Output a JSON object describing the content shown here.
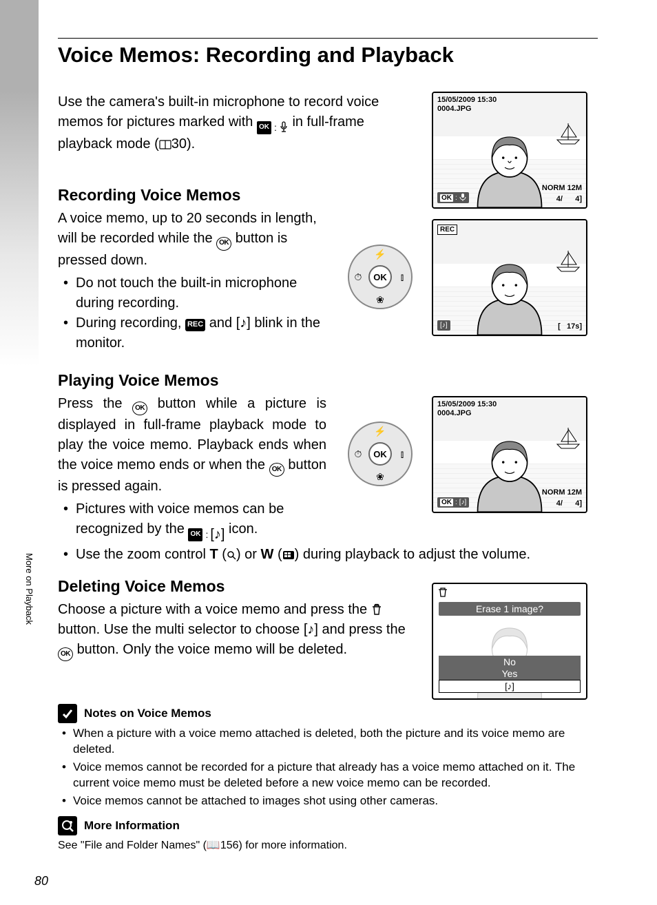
{
  "title": "Voice Memos: Recording and Playback",
  "intro": "Use the camera's built-in microphone to record voice memos for pictures marked with",
  "intro_after": " in full-frame playback mode (",
  "intro_ref": "30).",
  "section1": {
    "heading": "Recording Voice Memos",
    "body": "A voice memo, up to 20 seconds in length, will be recorded while the ",
    "body2": " button is pressed down.",
    "bullets": [
      "Do not touch the built-in microphone during recording.",
      "During recording, REC and [♪] blink in the monitor."
    ]
  },
  "section2": {
    "heading": "Playing Voice Memos",
    "body_a": "Press the ",
    "body_b": " button while a picture is displayed in full-frame playback mode to play the voice memo. Playback ends when the voice memo ends or when the ",
    "body_c": " button is pressed again.",
    "bullets": [
      "Pictures with voice memos can be recognized by the OK : [♪] icon.",
      "Use the zoom control T (🔍) or W (⊞) during playback to adjust the volume."
    ]
  },
  "section3": {
    "heading": "Deleting Voice Memos",
    "body_a": "Choose a picture with a voice memo and press the ",
    "body_b": " button. Use the multi selector to choose [♪] and press the ",
    "body_c": " button. Only the voice memo will be deleted."
  },
  "notes": {
    "heading": "Notes on Voice Memos",
    "bullets": [
      "When a picture with a voice memo attached is deleted, both the picture and its voice memo are deleted.",
      "Voice memos cannot be recorded for a picture that already has a voice memo attached on it. The current voice memo must be deleted before a new voice memo can be recorded.",
      "Voice memos cannot be attached to images shot using other cameras."
    ]
  },
  "more_info": {
    "heading": "More Information",
    "body": "See \"File and Folder Names\" (📖156) for more information."
  },
  "side_tab": "More on Playback",
  "page_num": "80",
  "screens": {
    "s1": {
      "date": "15/05/2009 15:30",
      "file": "0004.JPG",
      "norm": "NORM",
      "size": "12M",
      "count": "4/      4]",
      "ok_label": "OK"
    },
    "s2": {
      "rec": "REC",
      "time": "[   17s]"
    },
    "s3": {
      "date": "15/05/2009 15:30",
      "file": "0004.JPG",
      "norm": "NORM",
      "size": "12M",
      "count": "4/      4]",
      "ok_label": "OK"
    },
    "erase": {
      "prompt": "Erase 1 image?",
      "no": "No",
      "yes": "Yes",
      "memo_glyph": "[♪]"
    }
  },
  "icons": {
    "ok": "OK",
    "rec": "REC",
    "trash": "🗑",
    "book": "📖",
    "zoom_t": "T",
    "zoom_w": "W"
  }
}
